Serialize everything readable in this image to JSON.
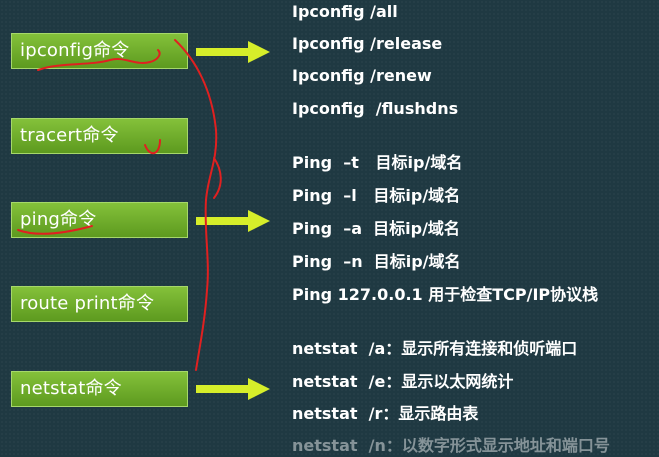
{
  "boxes": [
    {
      "label": "ipconfig命令"
    },
    {
      "label": "tracert命令"
    },
    {
      "label": "ping命令"
    },
    {
      "label": "route print命令"
    },
    {
      "label": "netstat命令"
    }
  ],
  "ipconfig_cmds": [
    "Ipconfig /all",
    "Ipconfig /release",
    "Ipconfig /renew",
    "Ipconfig  /flushdns"
  ],
  "ping_cmds": [
    "Ping  –t   目标ip/域名",
    "Ping  –l   目标ip/域名",
    "Ping  –a  目标ip/域名",
    "Ping  –n  目标ip/域名",
    "Ping 127.0.0.1 用于检查TCP/IP协议栈"
  ],
  "netstat_cmds": [
    "netstat  /a：显示所有连接和侦听端口",
    "netstat  /e：显示以太网统计",
    "netstat  /r：显示路由表",
    "netstat  /n：以数字形式显示地址和端口号"
  ],
  "colors": {
    "background": "#1f3942",
    "box": "#74b02e",
    "arrow": "#d6ee2a",
    "ink": "#e02020"
  }
}
